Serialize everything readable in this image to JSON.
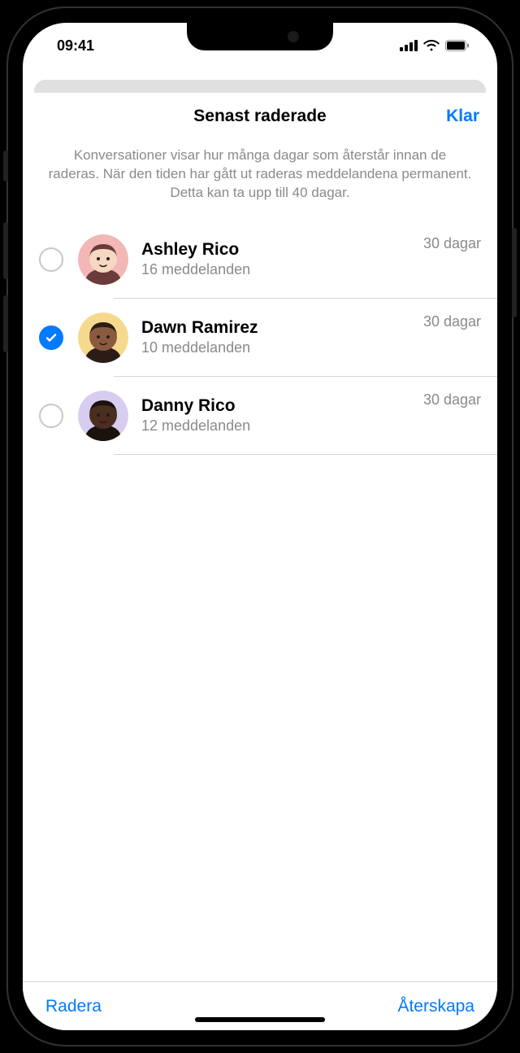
{
  "status": {
    "time": "09:41"
  },
  "sheet": {
    "title": "Senast raderade",
    "done": "Klar",
    "description": "Konversationer visar hur många dagar som återstår innan de raderas. När den tiden har gått ut raderas meddelandena permanent. Detta kan ta upp till 40 dagar."
  },
  "conversations": [
    {
      "name": "Ashley Rico",
      "subtitle": "16 meddelanden",
      "days": "30 dagar",
      "selected": false,
      "avatar_bg": "#f3b7b5",
      "avatar_skin": "#f6d7c2",
      "avatar_hair": "#6b3a3a"
    },
    {
      "name": "Dawn Ramirez",
      "subtitle": "10 meddelanden",
      "days": "30 dagar",
      "selected": true,
      "avatar_bg": "#f6d98e",
      "avatar_skin": "#8a5a3f",
      "avatar_hair": "#2a1d18"
    },
    {
      "name": "Danny Rico",
      "subtitle": "12 meddelanden",
      "days": "30 dagar",
      "selected": false,
      "avatar_bg": "#d6cdf0",
      "avatar_skin": "#4a2e20",
      "avatar_hair": "#1a120d"
    }
  ],
  "toolbar": {
    "delete": "Radera",
    "recover": "Återskapa"
  }
}
